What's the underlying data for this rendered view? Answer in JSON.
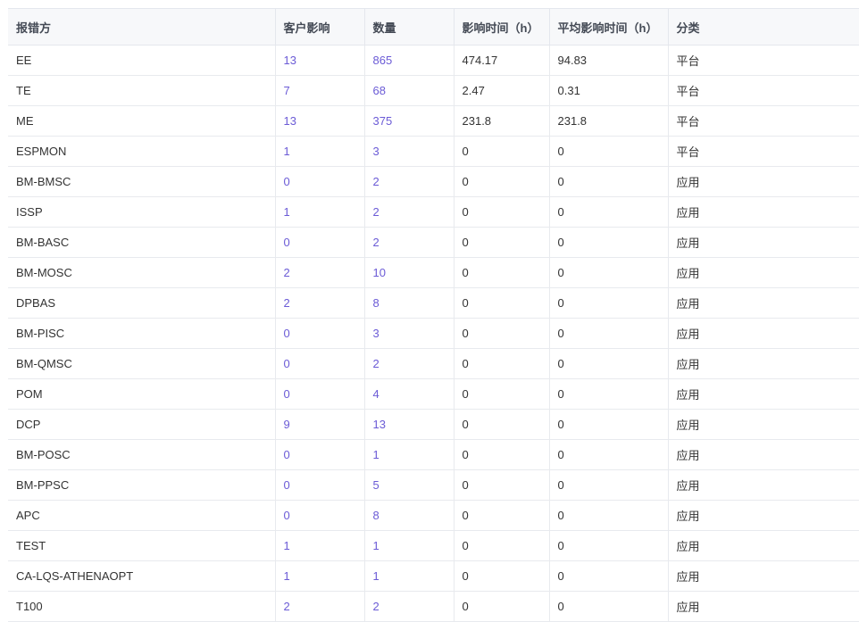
{
  "table": {
    "headers": [
      "报错方",
      "客户影响",
      "数量",
      "影响时间（h）",
      "平均影响时间（h）",
      "分类"
    ],
    "rows": [
      [
        "EE",
        "13",
        "865",
        "474.17",
        "94.83",
        "平台"
      ],
      [
        "TE",
        "7",
        "68",
        "2.47",
        "0.31",
        "平台"
      ],
      [
        "ME",
        "13",
        "375",
        "231.8",
        "231.8",
        "平台"
      ],
      [
        "ESPMON",
        "1",
        "3",
        "0",
        "0",
        "平台"
      ],
      [
        "BM-BMSC",
        "0",
        "2",
        "0",
        "0",
        "应用"
      ],
      [
        "ISSP",
        "1",
        "2",
        "0",
        "0",
        "应用"
      ],
      [
        "BM-BASC",
        "0",
        "2",
        "0",
        "0",
        "应用"
      ],
      [
        "BM-MOSC",
        "2",
        "10",
        "0",
        "0",
        "应用"
      ],
      [
        "DPBAS",
        "2",
        "8",
        "0",
        "0",
        "应用"
      ],
      [
        "BM-PISC",
        "0",
        "3",
        "0",
        "0",
        "应用"
      ],
      [
        "BM-QMSC",
        "0",
        "2",
        "0",
        "0",
        "应用"
      ],
      [
        "POM",
        "0",
        "4",
        "0",
        "0",
        "应用"
      ],
      [
        "DCP",
        "9",
        "13",
        "0",
        "0",
        "应用"
      ],
      [
        "BM-POSC",
        "0",
        "1",
        "0",
        "0",
        "应用"
      ],
      [
        "BM-PPSC",
        "0",
        "5",
        "0",
        "0",
        "应用"
      ],
      [
        "APC",
        "0",
        "8",
        "0",
        "0",
        "应用"
      ],
      [
        "TEST",
        "1",
        "1",
        "0",
        "0",
        "应用"
      ],
      [
        "CA-LQS-ATHENAOPT",
        "1",
        "1",
        "0",
        "0",
        "应用"
      ],
      [
        "T100",
        "2",
        "2",
        "0",
        "0",
        "应用"
      ]
    ]
  },
  "colors": {
    "link": "#6b5bd6",
    "header_bg": "#f7f8fa",
    "border": "#e8eaee"
  }
}
